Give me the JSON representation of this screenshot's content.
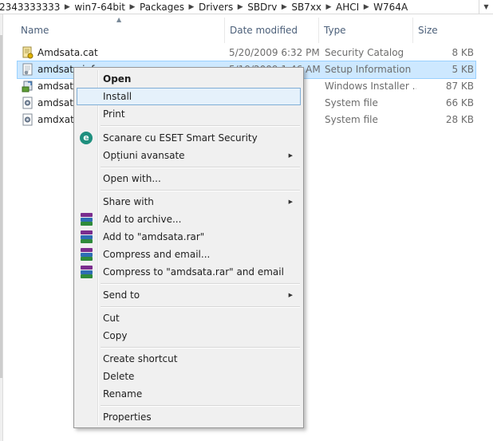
{
  "address_bar": {
    "crumbs": [
      "2343333333",
      "win7-64bit",
      "Packages",
      "Drivers",
      "SBDrv",
      "SB7xx",
      "AHCI",
      "W764A"
    ]
  },
  "columns": {
    "name": "Name",
    "date": "Date modified",
    "type": "Type",
    "size": "Size"
  },
  "files": [
    {
      "name": "Amdsata.cat",
      "date": "5/20/2009 6:32 PM",
      "type": "Security Catalog",
      "size": "8 KB",
      "icon": "catalog-icon"
    },
    {
      "name": "amdsata.inf",
      "date": "5/19/2009 1:46 AM",
      "type": "Setup Information",
      "size": "5 KB",
      "icon": "setup-info-icon",
      "selected": true
    },
    {
      "name": "amdsata",
      "date": "",
      "type": "Windows Installer ...",
      "size": "87 KB",
      "icon": "installer-icon"
    },
    {
      "name": "amdsata",
      "date": "",
      "type": "System file",
      "size": "66 KB",
      "icon": "system-file-icon"
    },
    {
      "name": "amdxata",
      "date": "",
      "type": "System file",
      "size": "28 KB",
      "icon": "system-file-icon"
    }
  ],
  "context_menu": {
    "open": "Open",
    "install": "Install",
    "print": "Print",
    "eset_scan": "Scanare cu ESET Smart Security",
    "advanced": "Opțiuni avansate",
    "open_with": "Open with...",
    "share_with": "Share with",
    "add_archive": "Add to archive...",
    "add_rar": "Add to \"amdsata.rar\"",
    "compress_email": "Compress and email...",
    "compress_rar_email": "Compress to \"amdsata.rar\" and email",
    "send_to": "Send to",
    "cut": "Cut",
    "copy": "Copy",
    "create_shortcut": "Create shortcut",
    "delete": "Delete",
    "rename": "Rename",
    "properties": "Properties"
  },
  "colors": {
    "selection": "#cde8ff",
    "menu_hover": "#e5f1fb",
    "eset": "#1e8f7e"
  }
}
